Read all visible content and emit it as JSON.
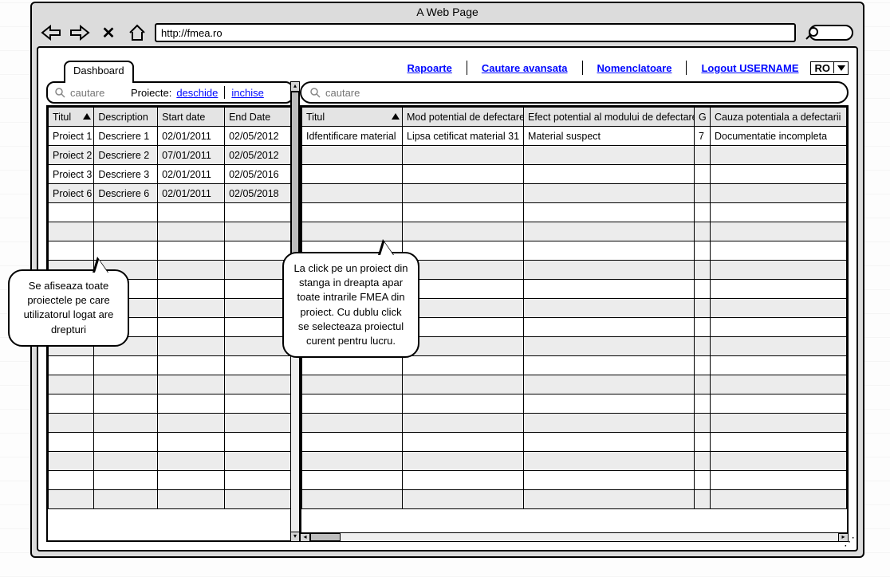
{
  "browser": {
    "title": "A Web Page",
    "url": "http://fmea.ro"
  },
  "tab": {
    "label": "Dashboard"
  },
  "topnav": {
    "rapoarte": "Rapoarte",
    "cautare_avansata": "Cautare avansata",
    "nomenclatoare": "Nomenclatoare",
    "logout": "Logout USERNAME",
    "lang": "RO"
  },
  "left_panel": {
    "search_placeholder": "cautare",
    "filter_label": "Proiecte:",
    "filter_open": "deschide",
    "filter_closed": "inchise",
    "headers": {
      "title": "Titul",
      "desc": "Description",
      "start": "Start date",
      "end": "End Date"
    },
    "rows": [
      {
        "title": "Proiect 1",
        "desc": "Descriere 1",
        "start": "02/01/2011",
        "end": "02/05/2012"
      },
      {
        "title": "Proiect 2",
        "desc": "Descriere 2",
        "start": "07/01/2011",
        "end": "02/05/2012"
      },
      {
        "title": "Proiect 3",
        "desc": "Descriere 3",
        "start": "02/01/2011",
        "end": "02/05/2016"
      },
      {
        "title": "Proiect 6",
        "desc": "Descriere 6",
        "start": "02/01/2011",
        "end": "02/05/2018"
      }
    ]
  },
  "right_panel": {
    "search_placeholder": "cautare",
    "headers": {
      "title": "Titul",
      "mode": "Mod potential de defectare",
      "efect": "Efect potential al modului de defectare",
      "g": "G",
      "cauza": "Cauza potentiala a defectarii"
    },
    "rows": [
      {
        "title": "Idfentificare material",
        "mode": "Lipsa cetificat material 31",
        "efect": "Material  suspect",
        "g": "7",
        "cauza": "Documentatie incompleta"
      }
    ]
  },
  "bubbles": {
    "left": "Se afiseaza toate proiectele pe care utilizatorul logat are drepturi",
    "mid": "La click pe un proiect din stanga in dreapta apar toate intrarile FMEA din proiect. Cu dublu click se selecteaza proiectul curent pentru lucru."
  }
}
